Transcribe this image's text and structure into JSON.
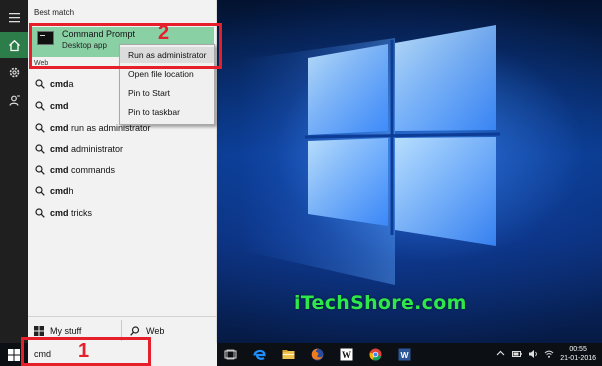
{
  "rail": {
    "items": [
      {
        "icon": "menu-icon"
      },
      {
        "icon": "home-icon",
        "active": true
      },
      {
        "icon": "gear-icon"
      },
      {
        "icon": "feedback-icon"
      }
    ]
  },
  "start_panel": {
    "best_match_label": "Best match",
    "best_match": {
      "title": "Command Prompt",
      "subtitle": "Desktop app",
      "icon": "command-prompt-icon"
    },
    "web_label": "Web",
    "suggestions": [
      {
        "prefix": "cmd",
        "rest": "a"
      },
      {
        "prefix": "cmd",
        "rest": ""
      },
      {
        "prefix": "cmd",
        "rest": " run as administrator"
      },
      {
        "prefix": "cmd",
        "rest": " administrator"
      },
      {
        "prefix": "cmd",
        "rest": " commands"
      },
      {
        "prefix": "cmd",
        "rest": "h"
      },
      {
        "prefix": "cmd",
        "rest": " tricks"
      }
    ],
    "bottom_tabs": {
      "my_stuff": "My stuff",
      "web": "Web"
    }
  },
  "context_menu": {
    "items": [
      {
        "label": "Run as administrator",
        "highlighted": true
      },
      {
        "label": "Open file location"
      },
      {
        "label": "Pin to Start"
      },
      {
        "label": "Pin to taskbar"
      }
    ]
  },
  "annotations": {
    "one": "1",
    "two": "2",
    "color": "#e5202a"
  },
  "taskbar": {
    "search_value": "cmd",
    "apps": [
      "task-view-icon",
      "edge-icon",
      "file-explorer-icon",
      "firefox-icon",
      "word-icon",
      "chrome-icon",
      "word-doc-icon"
    ],
    "clock": {
      "time": "00:55",
      "date": "21-01-2016"
    }
  },
  "desktop": {
    "watermark": "iTechShore.com"
  },
  "colors": {
    "accent": "#2d7d4b",
    "best_match_bg": "#8ad0a5",
    "watermark": "#2ee84a"
  }
}
